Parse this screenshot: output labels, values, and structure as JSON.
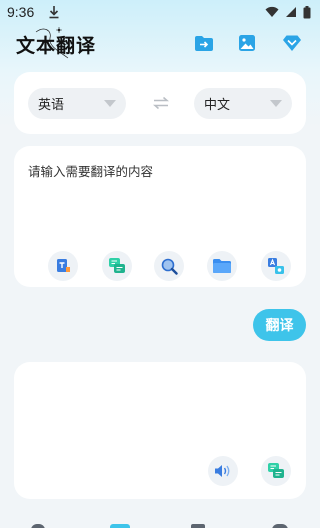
{
  "status_bar": {
    "time": "9:36"
  },
  "header": {
    "title": "文本翻译",
    "icons": [
      "folder-export-icon",
      "image-icon",
      "vip-diamond-icon"
    ]
  },
  "languages": {
    "source": "英语",
    "target": "中文"
  },
  "input": {
    "placeholder": "请输入需要翻译的内容",
    "value": ""
  },
  "input_tools": [
    "translate-file-icon",
    "chat-dialog-icon",
    "search-icon",
    "folder-icon",
    "image-translate-icon"
  ],
  "translate_button": {
    "label": "翻译"
  },
  "output": {
    "value": "",
    "tools": [
      "speaker-icon",
      "chat-dialog-icon"
    ]
  },
  "colors": {
    "accent": "#3ec4ea",
    "vip": "#2aa4e6",
    "green": "#2fd0a7"
  }
}
